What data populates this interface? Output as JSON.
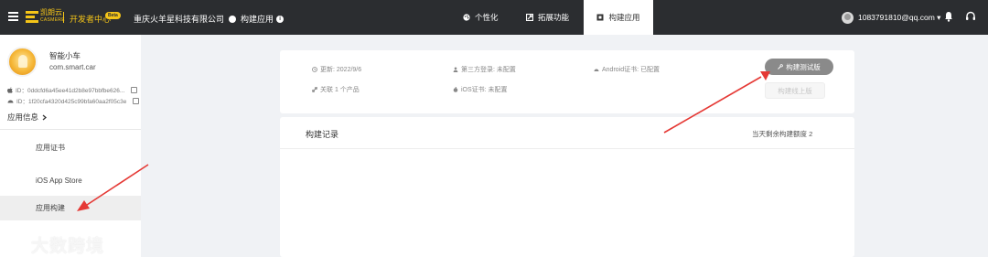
{
  "topbar": {
    "logo_text": "凯朗云",
    "logo_sub": "CASMERE",
    "dev_center": "开发者中心",
    "beta": "Beta",
    "company": "重庆火羊星科技有限公司",
    "crumb": "构建应用",
    "tabs": [
      {
        "label": "个性化",
        "icon": "palette-icon"
      },
      {
        "label": "拓展功能",
        "icon": "extension-icon"
      },
      {
        "label": "构建应用",
        "icon": "build-icon",
        "active": true
      }
    ],
    "user_email": "1083791810@qq.com ▾"
  },
  "sidebar": {
    "app_name": "智能小车",
    "package": "com.smart.car",
    "ios_id": "ID：0ddcfd6a45ee41d2b8e97bbfbe626...",
    "android_id": "ID：1f20cfa4320d425c99bfa60aa2f05c3e",
    "app_info": "应用信息",
    "menu": {
      "cert": "应用证书",
      "ios": "iOS App Store",
      "build": "应用构建"
    }
  },
  "build_card": {
    "update": "更新: 2022/9/6",
    "third_party": "第三方登录: 未配置",
    "android_cert": "Android证书: 已配置",
    "related": "关联 1 个产品",
    "ios_cert": "iOS证书: 未配置",
    "btn_test": "构建测试版",
    "btn_release": "构建线上版"
  },
  "records": {
    "title": "构建记录",
    "quota": "当天剩余构建额度 2"
  },
  "watermark": "大数跨境",
  "colors": {
    "topbar": "#2b2d30",
    "accent": "#f5c518",
    "arrow": "#e53935",
    "background": "#f0f2f5"
  }
}
